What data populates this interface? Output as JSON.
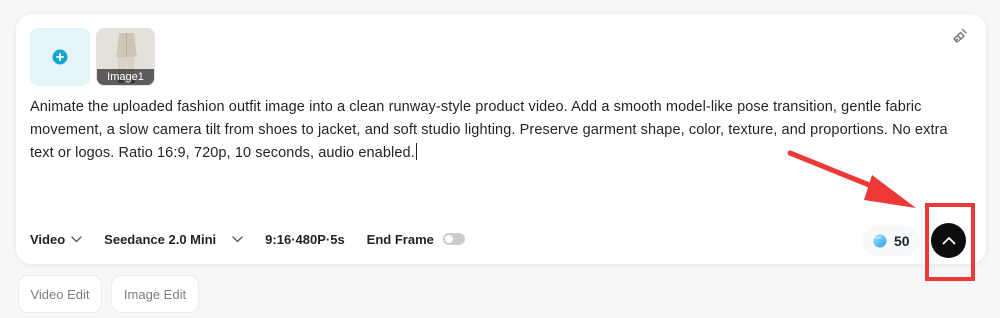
{
  "attachments": {
    "add_icon": "plus-circle-icon",
    "image_label": "Image1"
  },
  "prompt": {
    "text": "Animate the uploaded fashion outfit image into a clean runway-style product video. Add a smooth model-like pose transition, gentle fabric movement, a slow camera tilt from shoes to jacket, and soft studio lighting. Preserve garment shape, color, texture, and proportions. No extra text or logos. Ratio 16:9, 720p, 10 seconds, audio enabled."
  },
  "toolbar": {
    "mode": "Video",
    "model": "Seedance 2.0 Mini",
    "settings": "9:16·480P·5s",
    "end_frame_label": "End Frame",
    "end_frame_enabled": false
  },
  "credits": {
    "value": "50",
    "icon": "gem-icon"
  },
  "send": {
    "icon": "arrow-up-icon"
  },
  "chips": {
    "video_edit": "Video Edit",
    "image_edit": "Image Edit"
  },
  "colors": {
    "accent": "#16a5cf",
    "annotation_red": "#ee3838",
    "send_button": "#0d0d0d",
    "add_tile_bg": "#e5f4f8"
  }
}
